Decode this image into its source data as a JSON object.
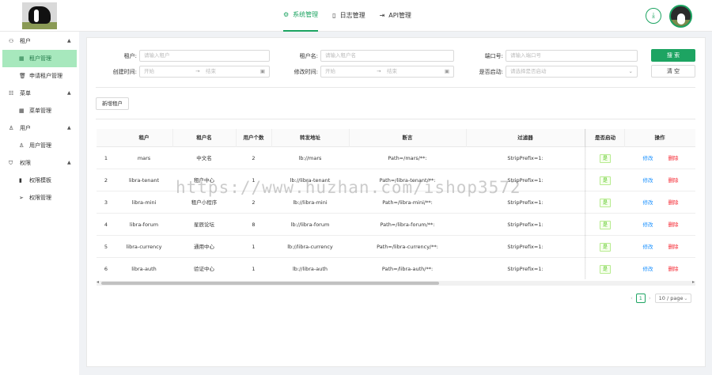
{
  "header": {
    "tabs": [
      {
        "label": "系统管理",
        "icon": "gear-icon",
        "active": true
      },
      {
        "label": "日志管理",
        "icon": "document-icon",
        "active": false
      },
      {
        "label": "API管理",
        "icon": "api-icon",
        "active": false
      }
    ]
  },
  "sidebar": {
    "groups": [
      {
        "label": "租户",
        "icon": "tenant-icon",
        "items": [
          {
            "label": "租户管理",
            "icon": "table-icon",
            "active": true
          },
          {
            "label": "申请租户管理",
            "icon": "trash-icon",
            "active": false
          }
        ]
      },
      {
        "label": "菜单",
        "icon": "menu-icon",
        "items": [
          {
            "label": "菜单管理",
            "icon": "table-icon",
            "active": false
          }
        ]
      },
      {
        "label": "用户",
        "icon": "user-icon",
        "items": [
          {
            "label": "用户管理",
            "icon": "user-icon",
            "active": false
          }
        ]
      },
      {
        "label": "权限",
        "icon": "shield-icon",
        "items": [
          {
            "label": "权限模板",
            "icon": "file-icon",
            "active": false
          },
          {
            "label": "权限管理",
            "icon": "send-icon",
            "active": false
          }
        ]
      }
    ]
  },
  "filters": {
    "tenant": {
      "label": "租户:",
      "placeholder": "请输入租户"
    },
    "tenant_name": {
      "label": "租户名:",
      "placeholder": "请输入租户名"
    },
    "port": {
      "label": "端口号:",
      "placeholder": "请输入端口号"
    },
    "created": {
      "label": "创建时间:",
      "start": "开始",
      "end": "结束"
    },
    "modified": {
      "label": "修改时间:",
      "start": "开始",
      "end": "结束"
    },
    "enabled": {
      "label": "是否启动:",
      "placeholder": "请选择是否启动"
    },
    "search_label": "搜 索",
    "clear_label": "清 空",
    "add_label": "新增租户"
  },
  "table": {
    "columns": [
      "租户",
      "租户名",
      "用户个数",
      "转发地址",
      "断言",
      "过滤器",
      "是否启动",
      "操作"
    ],
    "rows": [
      {
        "index": "1",
        "tenant": "mars",
        "name": "中文名",
        "users": "2",
        "uri": "lb://mars",
        "predicate": "Path=/mars/**:",
        "filter": "StripPrefix=1:",
        "enabled": "是"
      },
      {
        "index": "2",
        "tenant": "libra-tenant",
        "name": "租户中心",
        "users": "1",
        "uri": "lb://libra-tenant",
        "predicate": "Path=/libra-tenant/**:",
        "filter": "StripPrefix=1:",
        "enabled": "是"
      },
      {
        "index": "3",
        "tenant": "libra-mini",
        "name": "租户小程序",
        "users": "2",
        "uri": "lb://libra-mini",
        "predicate": "Path=/libra-mini/**:",
        "filter": "StripPrefix=1:",
        "enabled": "是"
      },
      {
        "index": "4",
        "tenant": "libra-forum",
        "name": "星辰论坛",
        "users": "8",
        "uri": "lb://libra-forum",
        "predicate": "Path=/libra-forum/**:",
        "filter": "StripPrefix=1:",
        "enabled": "是"
      },
      {
        "index": "5",
        "tenant": "libra-currency",
        "name": "通用中心",
        "users": "1",
        "uri": "lb://libra-currency",
        "predicate": "Path=/libra-currency/**:",
        "filter": "StripPrefix=1:",
        "enabled": "是"
      },
      {
        "index": "6",
        "tenant": "libra-auth",
        "name": "验证中心",
        "users": "1",
        "uri": "lb://libra-auth",
        "predicate": "Path=/libra-auth/**:",
        "filter": "StripPrefix=1:",
        "enabled": "是"
      }
    ],
    "edit_label": "修改",
    "delete_label": "删除"
  },
  "pagination": {
    "current": "1",
    "page_size": "10 / page"
  },
  "watermark": "https://www.huzhan.com/ishop3572",
  "colors": {
    "primary": "#1da462",
    "link": "#1890ff",
    "danger": "#f5222d"
  }
}
